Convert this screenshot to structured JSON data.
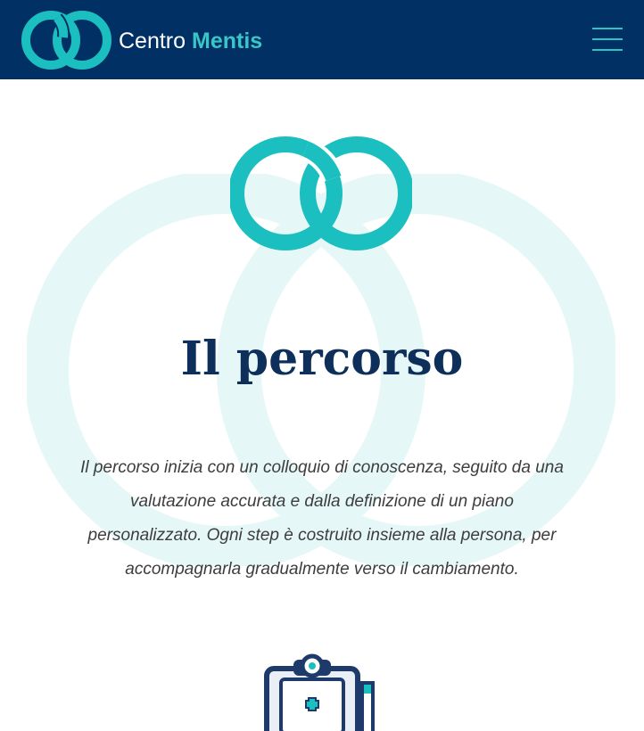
{
  "header": {
    "brand_word1": "Centro",
    "brand_word2": "Mentis",
    "logo_icon": "interlocked-rings-logo",
    "menu_icon": "hamburger-menu-icon"
  },
  "section": {
    "title": "Il percorso",
    "description": "Il percorso inizia con un colloquio di conoscenza, seguito da una valutazione accurata e dalla definizione di un piano personalizzato. Ogni step è costruito insieme alla persona, per accompagnarla gradualmente verso il cambiamento.",
    "icon": "medical-clipboard-icon"
  },
  "colors": {
    "header_bg": "#003064",
    "accent_teal": "#1cbfbf",
    "title_navy": "#0d2f5a",
    "body_text": "#3d3d3d",
    "watermark": "#e6f7f7"
  }
}
